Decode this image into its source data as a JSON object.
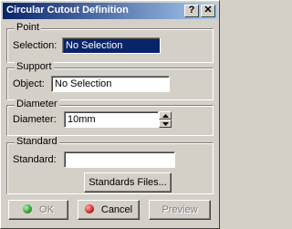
{
  "window": {
    "title": "Circular Cutout Definition",
    "help_label": "?",
    "close_label": "✕"
  },
  "point": {
    "legend": "Point",
    "selection_label": "Selection:",
    "selection_value": "No Selection"
  },
  "support": {
    "legend": "Support",
    "object_label": "Object:",
    "object_value": "No Selection"
  },
  "diameter": {
    "legend": "Diameter",
    "diameter_label": "Diameter:",
    "diameter_value": "10mm"
  },
  "standard": {
    "legend": "Standard",
    "standard_label": "Standard:",
    "standard_value": "",
    "files_button": "Standards Files..."
  },
  "buttons": {
    "ok": "OK",
    "cancel": "Cancel",
    "preview": "Preview"
  },
  "icons": {
    "ok": "green-dot-icon",
    "cancel": "red-dot-icon",
    "spin_up": "spin-up-icon",
    "spin_down": "spin-down-icon"
  },
  "colors": {
    "titlebar_start": "#0a246a",
    "titlebar_end": "#a6caf0",
    "selection_highlight": "#0a246a",
    "dialog_bg": "#d4d0c8"
  }
}
